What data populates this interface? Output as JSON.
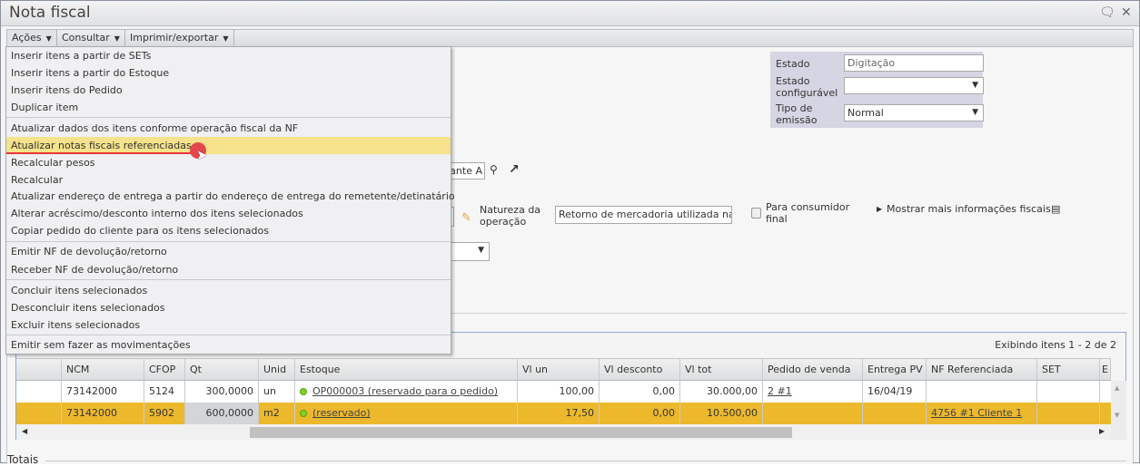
{
  "window": {
    "title": "Nota fiscal"
  },
  "toolbar": {
    "acoes": "Ações",
    "consultar": "Consultar",
    "imprimir": "Imprimir/exportar"
  },
  "menu": {
    "items": [
      "Inserir itens a partir de SETs",
      "Inserir itens a partir do Estoque",
      "Inserir itens do Pedido",
      "Duplicar item",
      "Atualizar dados dos itens conforme operação fiscal da NF",
      "Atualizar notas fiscais referenciadas",
      "Recalcular pesos",
      "Recalcular",
      "Atualizar endereço de entrega a partir do endereço de entrega do remetente/detinatário",
      "Alterar acréscimo/desconto interno dos itens selecionados",
      "Copiar pedido do cliente para os itens selecionados",
      "Emitir NF de devolução/retorno",
      "Receber NF de devolução/retorno",
      "Concluir itens selecionados",
      "Desconcluir itens selecionados",
      "Excluir itens selecionados",
      "Emitir sem fazer as movimentações"
    ],
    "highlight_color": "#f5e28a"
  },
  "status": {
    "estado_label": "Estado",
    "estado_value": "Digitação",
    "configuravel_label_1": "Estado",
    "configuravel_label_2": "configurável",
    "configuravel_value": "",
    "tipo_label_1": "Tipo de",
    "tipo_label_2": "emissão",
    "tipo_value": "Normal"
  },
  "form": {
    "partial_input": "tante A",
    "natureza_label_1": "Natureza da",
    "natureza_label_2": "operação",
    "natureza_value": "Retorno de mercadoria utilizada na",
    "consumidor_label_1": "Para consumidor",
    "consumidor_label_2": "final",
    "mais_info": "Mostrar mais informações fiscais"
  },
  "grid": {
    "paging": "Exibindo itens 1 - 2 de 2",
    "columns": [
      "NCM",
      "CFOP",
      "Qt",
      "Unid",
      "Estoque",
      "Vl un",
      "Vl desconto",
      "Vl tot",
      "Pedido de venda",
      "Entrega PV",
      "NF Referenciada",
      "SET",
      "E"
    ],
    "rows": [
      {
        "ncm": "73142000",
        "cfop": "5124",
        "qt": "300,0000",
        "unid": "un",
        "estoque": "OP000003 (reservado para o pedido)",
        "vlun": "100,00",
        "desc": "0,00",
        "tot": "30.000,00",
        "pedido": "2 #1",
        "entrega": "16/04/19",
        "nfref": ""
      },
      {
        "ncm": "73142000",
        "cfop": "5902",
        "qt": "600,0000",
        "unid": "m2",
        "estoque": "(reservado)",
        "vlun": "17,50",
        "desc": "0,00",
        "tot": "10.500,00",
        "pedido": "",
        "entrega": "",
        "nfref": "4756 #1 Cliente 1"
      }
    ],
    "selected_color": "#ecb82c"
  },
  "totais": "Totais"
}
